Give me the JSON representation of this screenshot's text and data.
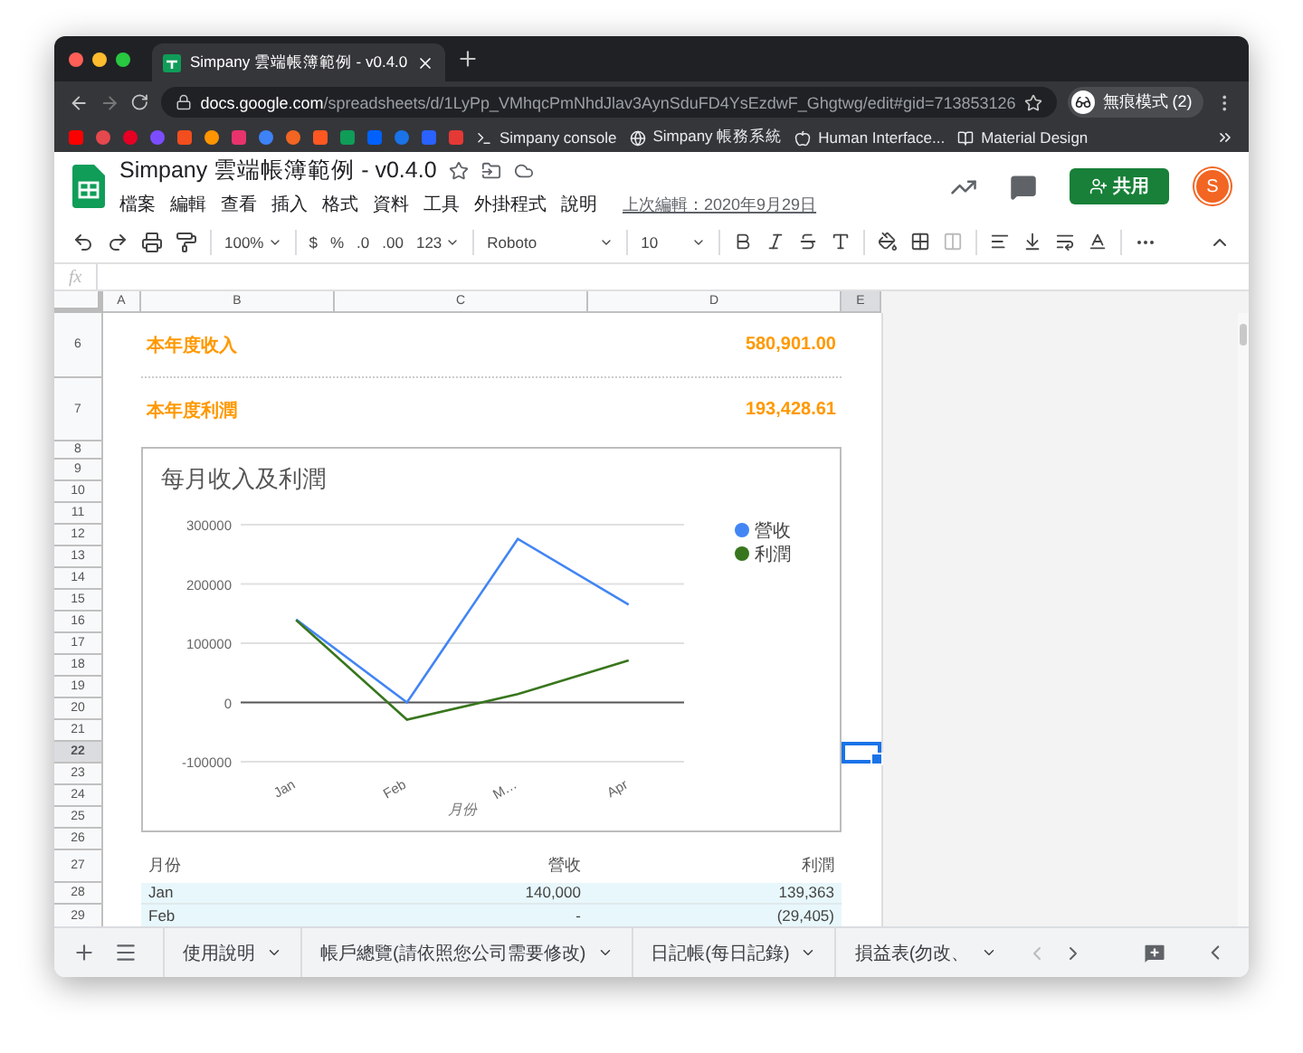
{
  "browser": {
    "tab_title": "Simpany 雲端帳簿範例 - v0.4.0",
    "url": "**docs.google.com**/spreadsheets/d/1LyPp_VMhqcPmNhdJlav3AynSduFD4YsEzdwF_Ghgtwg/edit#gid=713853126",
    "profile": "無痕模式 (2)",
    "bookmarks": [
      {
        "label": "Simpany console"
      },
      {
        "label": "Simpany 帳務系統"
      },
      {
        "label": "Human Interface..."
      },
      {
        "label": "Material Design"
      }
    ]
  },
  "document": {
    "title": "Simpany 雲端帳簿範例 - v0.4.0",
    "menus": [
      "檔案",
      "編輯",
      "查看",
      "插入",
      "格式",
      "資料",
      "工具",
      "外掛程式",
      "說明"
    ],
    "last_edit": "上次編輯：2020年9月29日",
    "share": "共用",
    "avatar": "S"
  },
  "toolbar": {
    "zoom": "100%",
    "currency": "$",
    "percent": "%",
    "decimals_less": ".0",
    "decimals_more": ".00",
    "number_format": "123",
    "font": "Roboto",
    "font_size": "10"
  },
  "formula_bar": {
    "label": "fx"
  },
  "columns": [
    {
      "label": "A",
      "selected": false
    },
    {
      "label": "B",
      "selected": false
    },
    {
      "label": "C",
      "selected": false
    },
    {
      "label": "D",
      "selected": false
    },
    {
      "label": "E",
      "selected": true
    }
  ],
  "rows": [
    {
      "label": "6",
      "selected": false
    },
    {
      "label": "7",
      "selected": false
    },
    {
      "label": "8",
      "selected": false
    },
    {
      "label": "9",
      "selected": false
    },
    {
      "label": "10",
      "selected": false
    },
    {
      "label": "11",
      "selected": false
    },
    {
      "label": "12",
      "selected": false
    },
    {
      "label": "13",
      "selected": false
    },
    {
      "label": "14",
      "selected": false
    },
    {
      "label": "15",
      "selected": false
    },
    {
      "label": "16",
      "selected": false
    },
    {
      "label": "17",
      "selected": false
    },
    {
      "label": "18",
      "selected": false
    },
    {
      "label": "19",
      "selected": false
    },
    {
      "label": "20",
      "selected": false
    },
    {
      "label": "21",
      "selected": false
    },
    {
      "label": "22",
      "selected": true
    },
    {
      "label": "23",
      "selected": false
    },
    {
      "label": "24",
      "selected": false
    },
    {
      "label": "25",
      "selected": false
    },
    {
      "label": "26",
      "selected": false
    },
    {
      "label": "27",
      "selected": false
    },
    {
      "label": "28",
      "selected": false
    },
    {
      "label": "29",
      "selected": false
    }
  ],
  "summary": [
    {
      "label": "本年度收入",
      "value": "580,901.00"
    },
    {
      "label": "本年度利潤",
      "value": "193,428.61"
    }
  ],
  "chart": {
    "chart_data": {
      "type": "line",
      "title": "每月收入及利潤",
      "xlabel": "月份",
      "categories": [
        "Jan",
        "Feb",
        "M…",
        "Apr"
      ],
      "series": [
        {
          "name": "營收",
          "color": "#4285f4",
          "values": [
            140000,
            0,
            276000,
            165000
          ]
        },
        {
          "name": "利潤",
          "color": "#38761d",
          "values": [
            139000,
            -29000,
            14000,
            71000
          ]
        }
      ],
      "ylim": [
        -100000,
        300000
      ],
      "yticks": [
        -100000,
        0,
        100000,
        200000,
        300000
      ],
      "legend": true
    }
  },
  "table": {
    "columns": [
      "月份",
      "營收",
      "利潤"
    ],
    "rows": [
      [
        "Jan",
        "140,000",
        "139,363"
      ],
      [
        "Feb",
        "-",
        "(29,405)"
      ]
    ]
  },
  "sheet_tabs": [
    {
      "label": "使用說明",
      "selected": false
    },
    {
      "label": "帳戶總覽(請依照您公司需要修改)",
      "selected": false
    },
    {
      "label": "日記帳(每日記錄)",
      "selected": false
    },
    {
      "label": "損益表(勿改、",
      "selected": false
    }
  ]
}
